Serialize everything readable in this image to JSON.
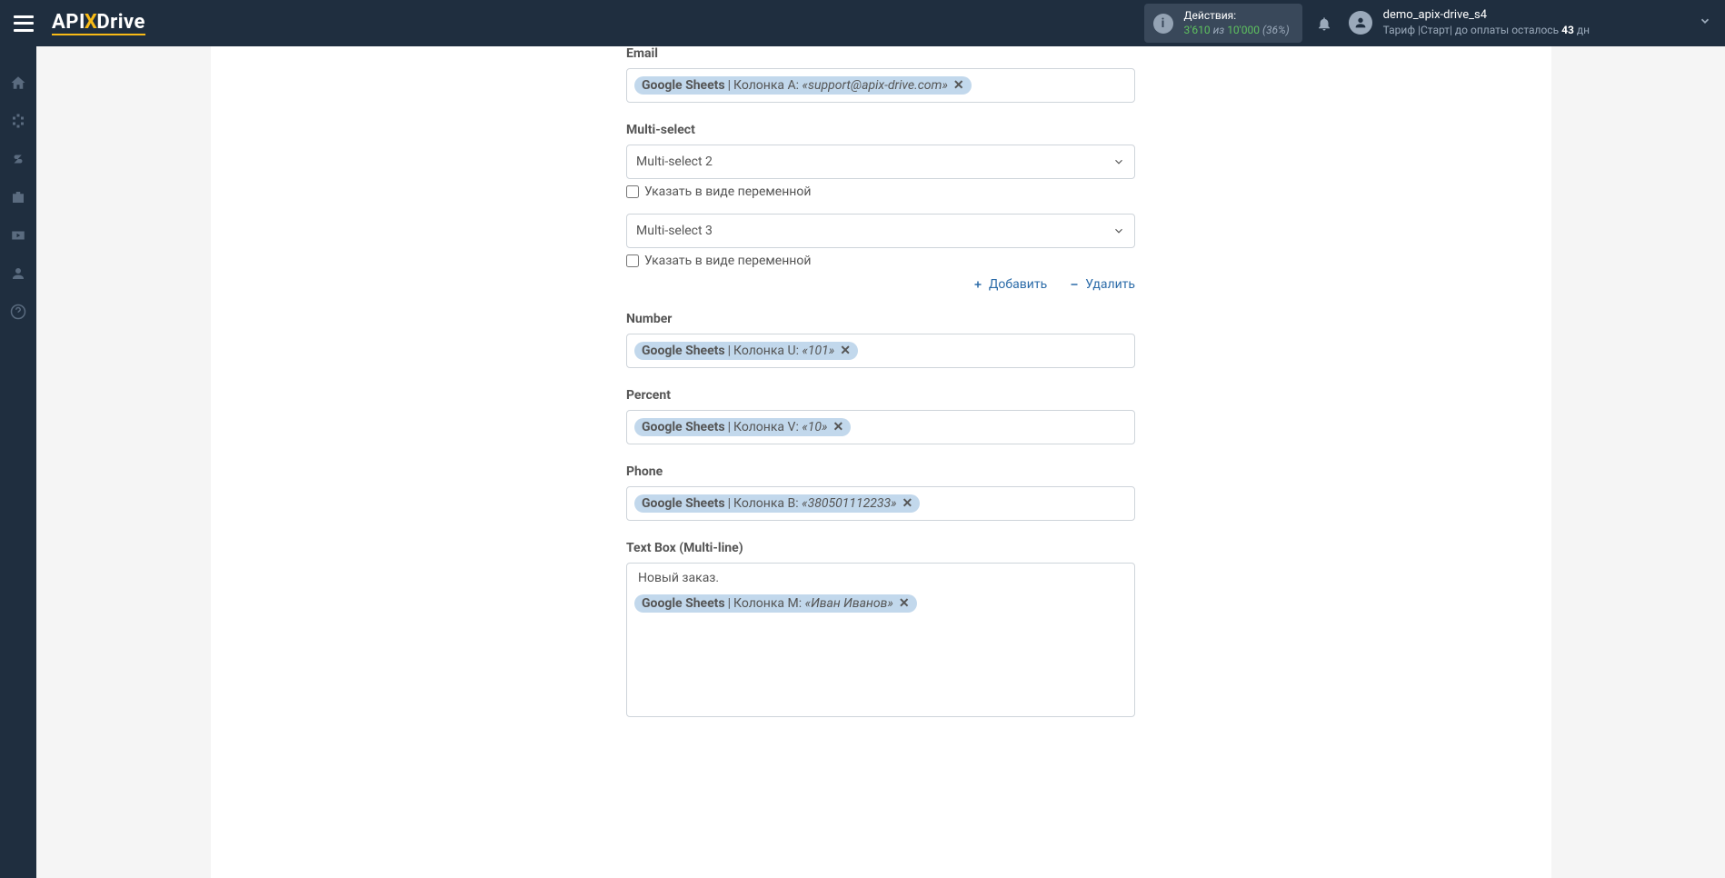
{
  "header": {
    "logo_text": "API Drive",
    "actions_label": "Действия:",
    "actions_current": "3'610",
    "actions_of": "из",
    "actions_total": "10'000",
    "actions_percent": "(36%)",
    "username": "demo_apix-drive_s4",
    "tariff_prefix": "Тариф |Старт| до оплаты осталось ",
    "tariff_days": "43",
    "tariff_suffix": " дн"
  },
  "fields": {
    "email": {
      "label": "Email",
      "tag_source": "Google Sheets",
      "tag_column": "Колонка A:",
      "tag_value": "«support@apix-drive.com»"
    },
    "multiselect": {
      "label": "Multi-select",
      "option1": "Multi-select 2",
      "option2": "Multi-select 3",
      "checkbox_label": "Указать в виде переменной",
      "add_label": "Добавить",
      "remove_label": "Удалить"
    },
    "number": {
      "label": "Number",
      "tag_source": "Google Sheets",
      "tag_column": "Колонка U:",
      "tag_value": "«101»"
    },
    "percent": {
      "label": "Percent",
      "tag_source": "Google Sheets",
      "tag_column": "Колонка V:",
      "tag_value": "«10»"
    },
    "phone": {
      "label": "Phone",
      "tag_source": "Google Sheets",
      "tag_column": "Колонка B:",
      "tag_value": "«380501112233»"
    },
    "textbox": {
      "label": "Text Box (Multi-line)",
      "plain_text": "Новый заказ.",
      "tag_source": "Google Sheets",
      "tag_column": "Колонка M:",
      "tag_value": "«Иван Иванов»"
    }
  }
}
